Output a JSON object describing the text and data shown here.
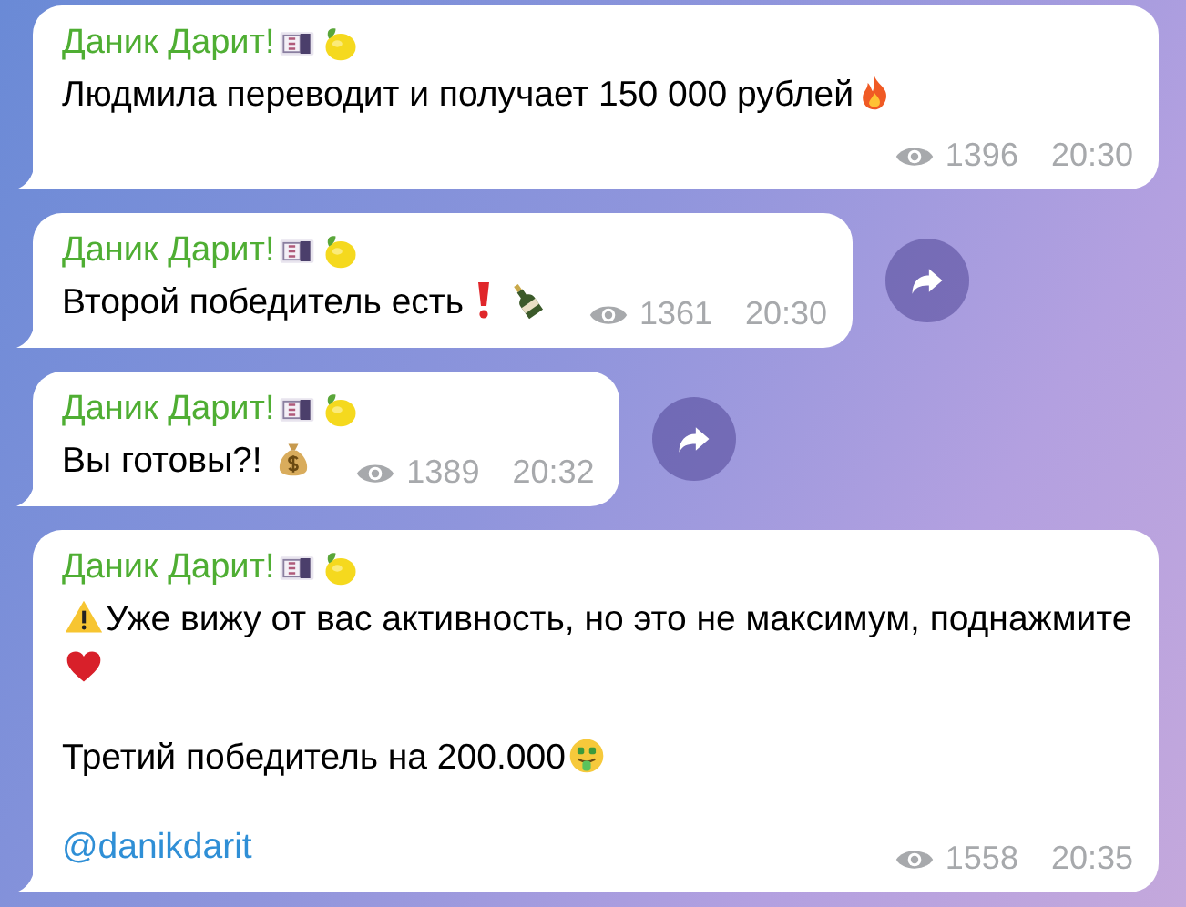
{
  "messages": [
    {
      "sender": [
        {
          "kind": "text",
          "text": "Даник Дарит!"
        },
        {
          "kind": "banknote"
        },
        {
          "kind": "lemon"
        }
      ],
      "paragraphs": [
        [
          {
            "kind": "text",
            "text": "Людмила переводит и получает 150 000 рублей"
          },
          {
            "kind": "fire"
          }
        ]
      ],
      "views": "1396",
      "time": "20:30",
      "share": false
    },
    {
      "sender": [
        {
          "kind": "text",
          "text": "Даник Дарит!"
        },
        {
          "kind": "banknote"
        },
        {
          "kind": "lemon"
        }
      ],
      "paragraphs": [
        [
          {
            "kind": "text",
            "text": "Второй победитель есть "
          },
          {
            "kind": "exclamation"
          },
          {
            "kind": "bottle"
          }
        ]
      ],
      "views": "1361",
      "time": "20:30",
      "share": true
    },
    {
      "sender": [
        {
          "kind": "text",
          "text": "Даник Дарит!"
        },
        {
          "kind": "banknote"
        },
        {
          "kind": "lemon"
        }
      ],
      "paragraphs": [
        [
          {
            "kind": "text",
            "text": "Вы готовы?! "
          },
          {
            "kind": "moneybag"
          }
        ]
      ],
      "views": "1389",
      "time": "20:32",
      "share": true
    },
    {
      "sender": [
        {
          "kind": "text",
          "text": "Даник Дарит!"
        },
        {
          "kind": "banknote"
        },
        {
          "kind": "lemon"
        }
      ],
      "paragraphs": [
        [
          {
            "kind": "warning"
          },
          {
            "kind": "text",
            "text": "Уже вижу от вас активность, но это не максимум, поднажмите"
          },
          {
            "kind": "heart"
          }
        ],
        [
          {
            "kind": "text",
            "text": "Третий победитель на 200.000"
          },
          {
            "kind": "moneyface"
          }
        ],
        [
          {
            "kind": "link",
            "text": "@danikdarit"
          }
        ]
      ],
      "views": "1558",
      "time": "20:35",
      "share": false
    }
  ]
}
